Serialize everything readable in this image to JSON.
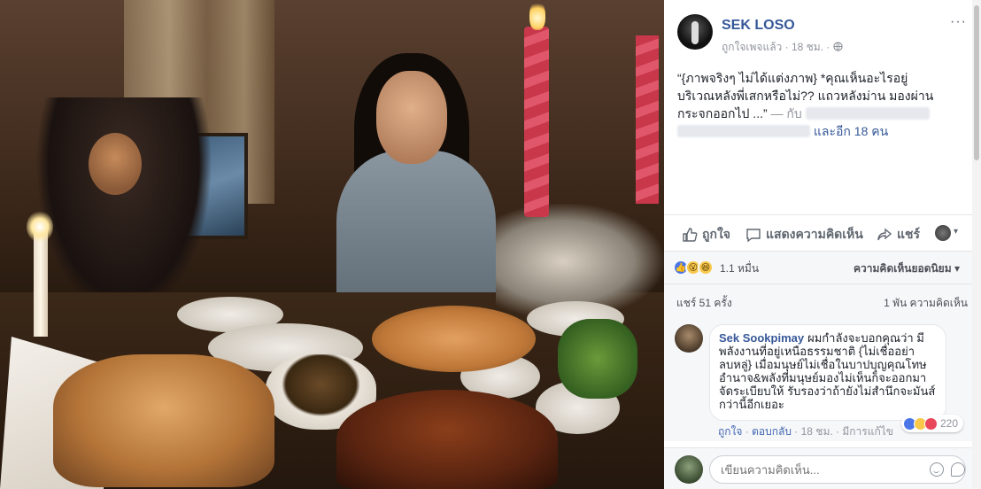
{
  "post": {
    "page_name": "SEK LOSO",
    "meta_prefix": "ถูกใจเพจแล้ว",
    "time": "18 ชม.",
    "dot": "·",
    "privacy_icon": "globe-icon",
    "more": "···",
    "text_line1": "“{ภาพจริงๆ ไม่ได้แต่งภาพ} *คุณเห็นอะไรอยู่",
    "text_line2": "บริเวณหลังพี่เสกหรือไม่?? แถวหลังม่าน มองผ่าน",
    "text_line3": "กระจกออกไป ...” ",
    "with_label": "— กับ",
    "and_others": "และอีก 18 คน"
  },
  "actions": {
    "like": "ถูกใจ",
    "comment": "แสดงความคิดเห็น",
    "share": "แชร์"
  },
  "reactions": {
    "count": "1.1 หมื่น",
    "sort_label": "ความคิดเห็นยอดนิยม",
    "sort_caret": "▾",
    "share_caret": "▾"
  },
  "stats": {
    "shares": "แชร์ 51 ครั้ง",
    "comments": "1 พัน ความคิดเห็น"
  },
  "comment": {
    "name": "Sek Sookpimay",
    "text": "ผมกำลังจะบอกคุณว่า มีพลังงานที่อยู่เหนือธรรมชาติ {ไม่เชื่ออย่าลบหลู่} เมื่อมนุษย์ไม่เชื่อในบาปบุญคุณโทษ อำนาจ&พลังที่มนุษย์มองไม่เห็นก็จะออกมาจัดระเบียบให้ รับรองว่าถ้ายังไม่สำนึกจะมันส์กว่านี้อีกเยอะ",
    "reaction_count": "220",
    "like": "ถูกใจ",
    "reply": "ตอบกลับ",
    "time": "18 ชม.",
    "edited": "มีการแก้ไข",
    "sep": " · "
  },
  "composer": {
    "placeholder": "เขียนความคิดเห็น..."
  },
  "colors": {
    "link": "#365899",
    "muted": "#90949c",
    "like_blue": "#4a76e8"
  }
}
